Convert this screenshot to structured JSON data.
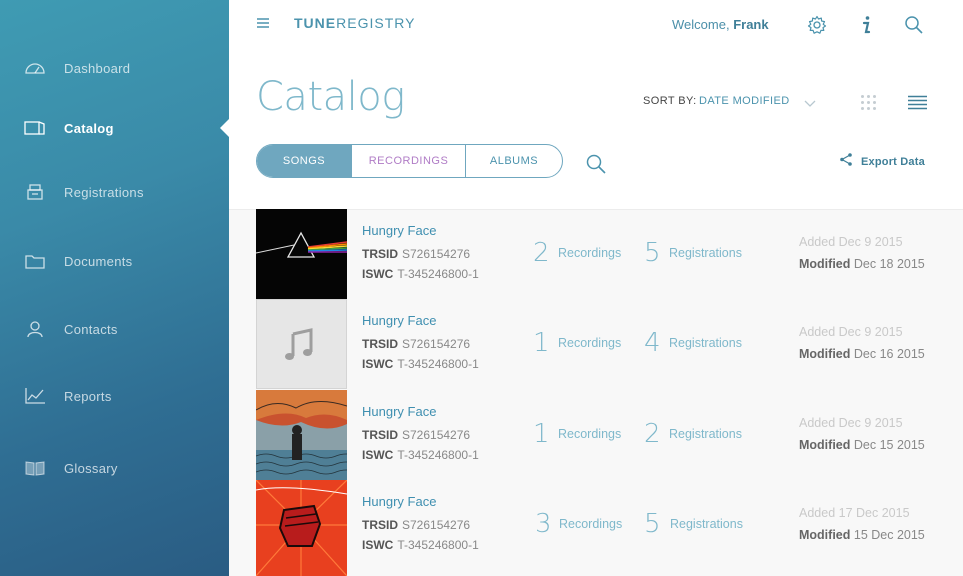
{
  "sidebar": {
    "items": [
      {
        "label": "Dashboard",
        "icon": "dashboard-icon"
      },
      {
        "label": "Catalog",
        "icon": "catalog-icon"
      },
      {
        "label": "Registrations",
        "icon": "registrations-icon"
      },
      {
        "label": "Documents",
        "icon": "folder-icon"
      },
      {
        "label": "Contacts",
        "icon": "contact-icon"
      },
      {
        "label": "Reports",
        "icon": "reports-chart-icon"
      },
      {
        "label": "Glossary",
        "icon": "glossary-book-icon"
      }
    ],
    "active_index": 1
  },
  "header": {
    "logo_bold": "TUNE",
    "logo_light": "REGISTRY",
    "welcome_prefix": "Welcome,",
    "user_name": "Frank",
    "icons": [
      "menu-icon",
      "settings-gear-icon",
      "info-icon",
      "search-icon"
    ]
  },
  "page": {
    "title": "Catalog",
    "sort_label": "SORT BY:",
    "sort_value": "DATE MODIFIED"
  },
  "tabs": {
    "songs": "SONGS",
    "recordings": "RECORDINGS",
    "albums": "ALBUMS",
    "active": "SONGS"
  },
  "export_label": "Export Data",
  "colors": {
    "accent": "#4b93ad",
    "recordings_tab": "#b07cc6",
    "sidebar_top": "#3f9bb3",
    "sidebar_bottom": "#2a5c83"
  },
  "rows": [
    {
      "name": "Hungry Face",
      "trsid_label": "TRSID",
      "trsid": "S726154276",
      "iswc_label": "ISWC",
      "iswc": "T-345246800-1",
      "recordings_count": "2",
      "recordings_label": "Recordings",
      "registrations_count": "5",
      "registrations_label": "Registrations",
      "added_label": "Added",
      "added": "Dec 9 2015",
      "modified_label": "Modified",
      "modified": "Dec 18 2015",
      "art": "prism-art"
    },
    {
      "name": "Hungry Face",
      "trsid_label": "TRSID",
      "trsid": "S726154276",
      "iswc_label": "ISWC",
      "iswc": "T-345246800-1",
      "recordings_count": "1",
      "recordings_label": "Recordings",
      "registrations_count": "4",
      "registrations_label": "Registrations",
      "added_label": "Added",
      "added": "Dec 9 2015",
      "modified_label": "Modified",
      "modified": "Dec 16 2015",
      "art": "music-note-placeholder"
    },
    {
      "name": "Hungry Face",
      "trsid_label": "TRSID",
      "trsid": "S726154276",
      "iswc_label": "ISWC",
      "iswc": "T-345246800-1",
      "recordings_count": "1",
      "recordings_label": "Recordings",
      "registrations_count": "2",
      "registrations_label": "Registrations",
      "added_label": "Added",
      "added": "Dec 9 2015",
      "modified_label": "Modified",
      "modified": "Dec 15 2015",
      "art": "illustrated-art"
    },
    {
      "name": "Hungry Face",
      "trsid_label": "TRSID",
      "trsid": "S726154276",
      "iswc_label": "ISWC",
      "iswc": "T-345246800-1",
      "recordings_count": "3",
      "recordings_label": "Recordings",
      "registrations_count": "5",
      "registrations_label": "Registrations",
      "added_label": "Added",
      "added": "17 Dec 2015",
      "modified_label": "Modified",
      "modified": "15 Dec 2015",
      "art": "red-fist-art"
    }
  ]
}
